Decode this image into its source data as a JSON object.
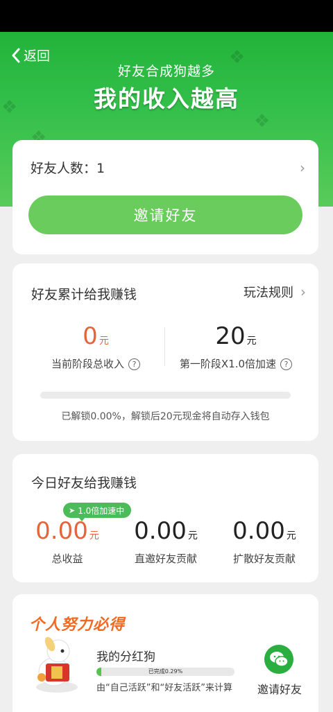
{
  "header": {
    "back_label": "返回",
    "subtitle": "好友合成狗越多",
    "title": "我的收入越高"
  },
  "friends": {
    "count_label": "好友人数：1",
    "invite_button": "邀请好友"
  },
  "cumulative": {
    "title": "好友累计给我赚钱",
    "rules_link": "玩法规则",
    "current_value": "0",
    "current_unit": "元",
    "current_label": "当前阶段总收入",
    "stage_value": "20",
    "stage_unit": "元",
    "stage_label": "第一阶段X1.0倍加速",
    "unlock_progress": 0.0,
    "unlock_text": "已解锁0.00%，解锁后20元现金将自动存入钱包"
  },
  "today": {
    "title": "今日好友给我赚钱",
    "badge": "1.0倍加速中",
    "total_value": "0.00",
    "total_unit": "元",
    "total_label": "总收益",
    "direct_value": "0.00",
    "direct_unit": "元",
    "direct_label": "直邀好友贡献",
    "spread_value": "0.00",
    "spread_unit": "元",
    "spread_label": "扩散好友贡献"
  },
  "effort": {
    "title": "个人努力必得",
    "dog_title": "我的分红狗",
    "progress_text": "已完成0.29%",
    "progress": 0.0029,
    "note": "由“自己活跃”和“好友活跃”来计算",
    "invite_label": "邀请好友"
  },
  "colors": {
    "brand_green": "#22b33a",
    "button_green": "#6bcc5e",
    "accent_red": "#e4643c",
    "effort_orange": "#f06a22"
  }
}
